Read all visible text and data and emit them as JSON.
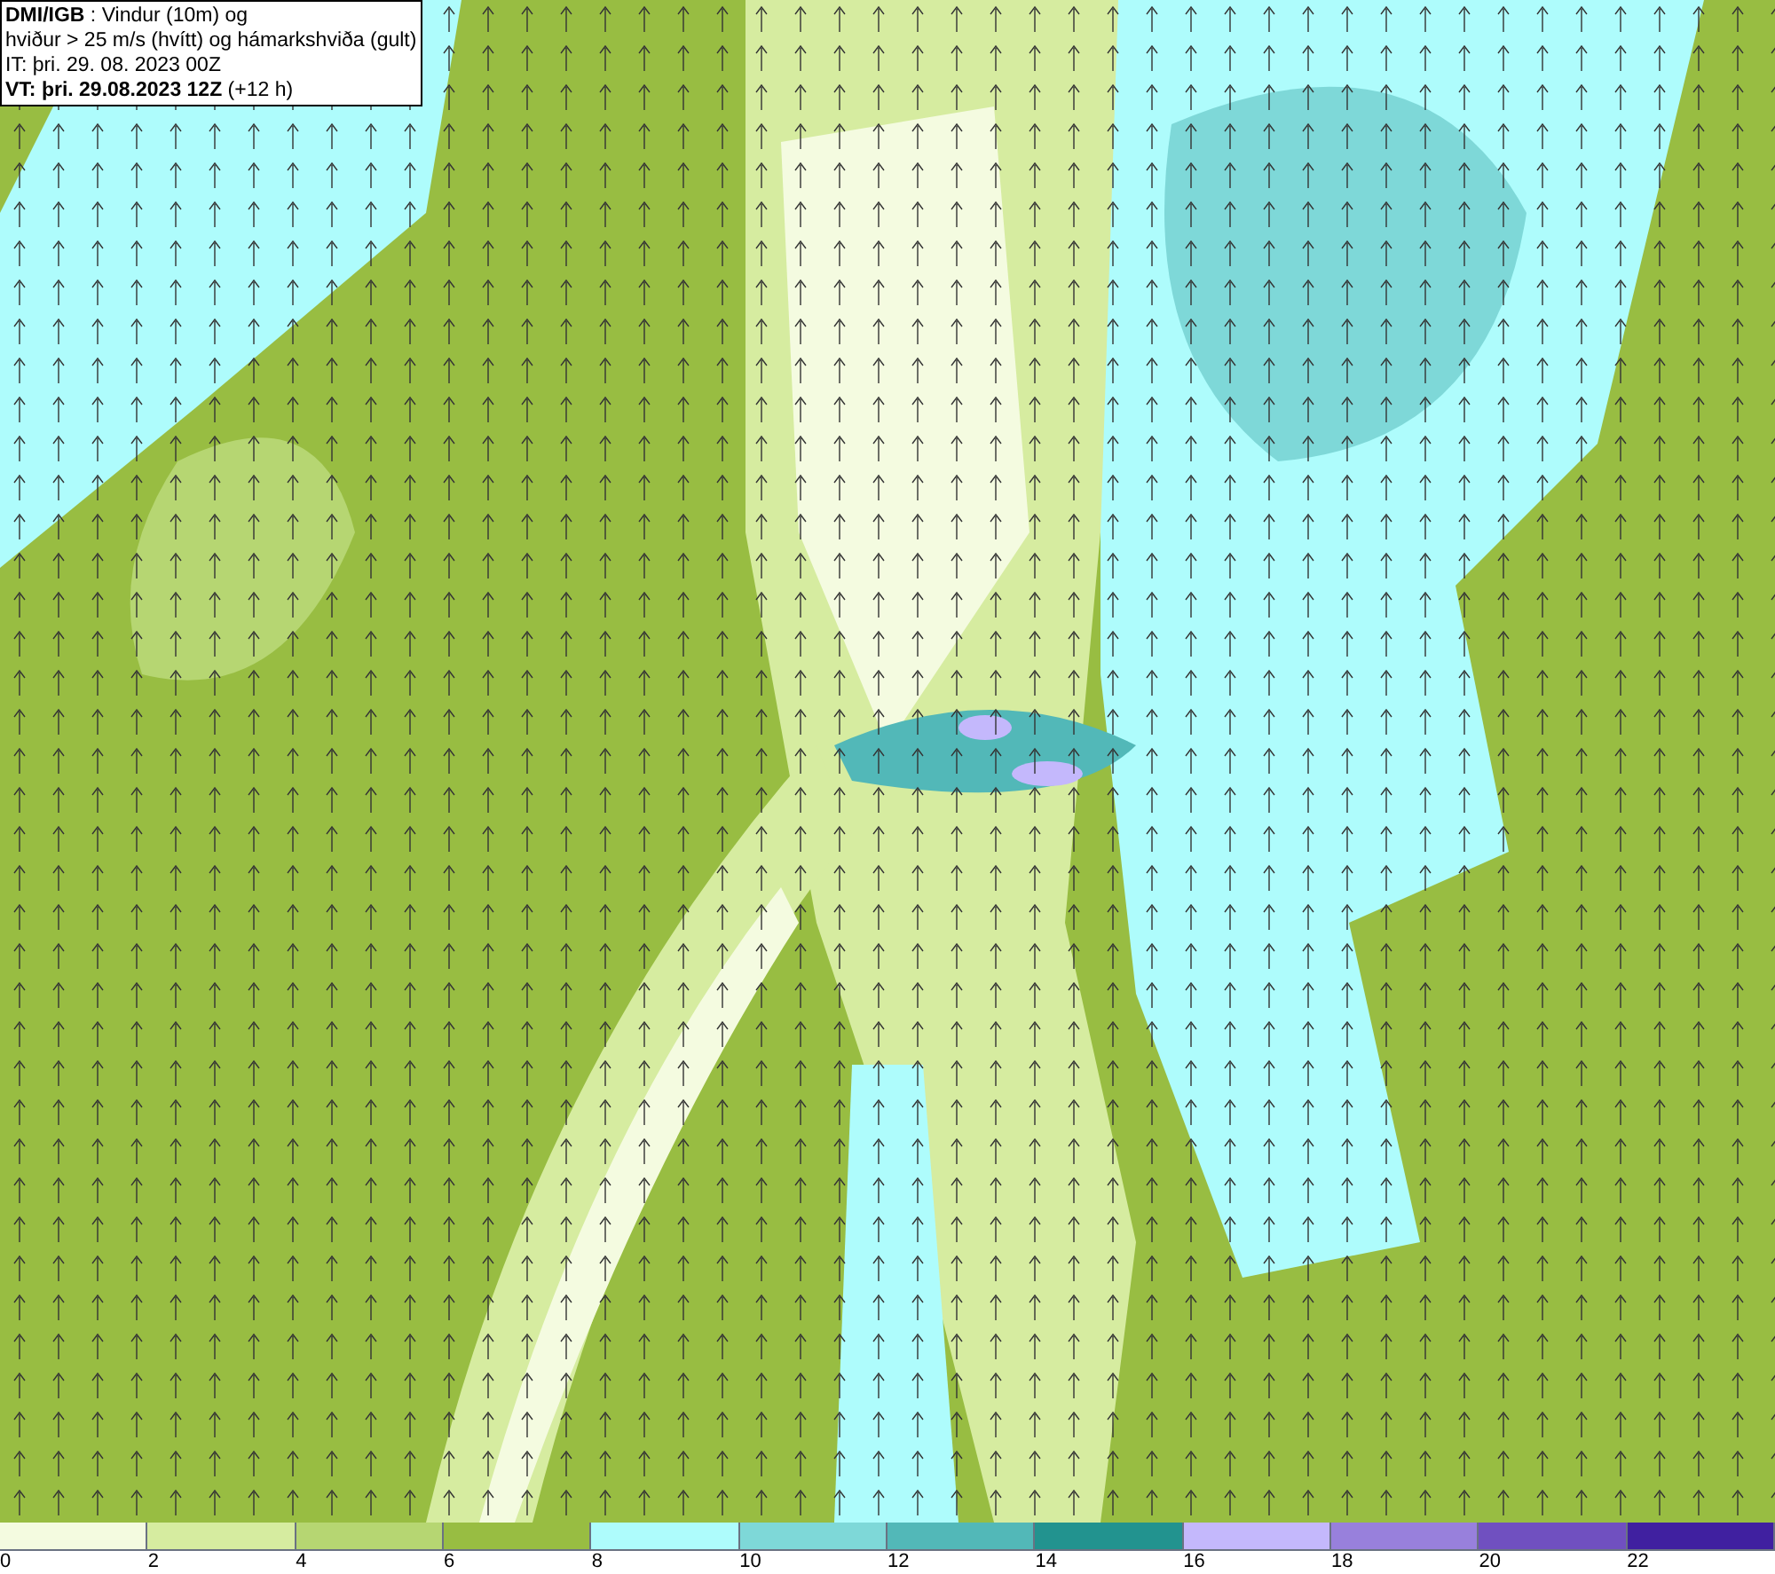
{
  "title_box": {
    "lines": [
      "**DMI/IGB** : Vindur (10m) og",
      "hviður > 25 m/s (hvítt) og hámarkshviða (gult)",
      "IT: þri. 29. 08. 2023 00Z",
      "**VT: þri. 29.08.2023 12Z** (+12 h)"
    ]
  },
  "legend": [
    {
      "label": "0",
      "color": "#f4fbe0"
    },
    {
      "label": "2",
      "color": "#d6eca0"
    },
    {
      "label": "4",
      "color": "#b6d672"
    },
    {
      "label": "6",
      "color": "#98bd42"
    },
    {
      "label": "8",
      "color": "#aefcfc"
    },
    {
      "label": "10",
      "color": "#7ed8d8"
    },
    {
      "label": "12",
      "color": "#52b8b8"
    },
    {
      "label": "14",
      "color": "#22938f"
    },
    {
      "label": "16",
      "color": "#c4b8fc"
    },
    {
      "label": "18",
      "color": "#9880dc"
    },
    {
      "label": "20",
      "color": "#7050c0"
    },
    {
      "label": "22",
      "color": "#4020a0"
    }
  ]
}
